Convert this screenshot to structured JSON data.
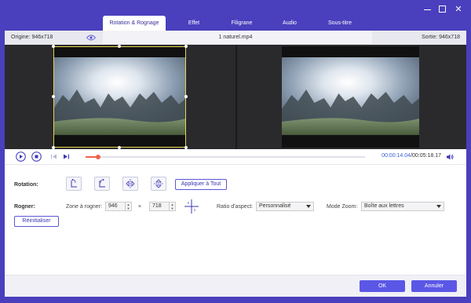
{
  "window": {
    "tabs": [
      {
        "label": "Rotation & Rognage",
        "active": true
      },
      {
        "label": "Effet",
        "active": false
      },
      {
        "label": "Filigrane",
        "active": false
      },
      {
        "label": "Audio",
        "active": false
      },
      {
        "label": "Sous-titre",
        "active": false
      }
    ],
    "accent_color": "#4a3fbd"
  },
  "info_bar": {
    "origin": "Origine: 946x718",
    "filename": "1 naturel.mp4",
    "output": "Sortie: 946x718"
  },
  "player": {
    "current_time": "00:00:14.04",
    "total_time": "/00:05:18.17",
    "progress_fraction": 0.046
  },
  "rotation": {
    "label": "Rotation:",
    "apply_all": "Appliquer à Tout"
  },
  "crop": {
    "label": "Rogner:",
    "zone_label": "Zone à rogner:",
    "width": "946",
    "height": "718",
    "times": "×",
    "aspect_label": "Ratio d'aspect:",
    "aspect_value": "Personnalisé",
    "zoom_label": "Mode Zoom:",
    "zoom_value": "Boîte aux lettres",
    "reset": "Réinitialiser"
  },
  "footer": {
    "ok": "OK",
    "cancel": "Annuler"
  }
}
